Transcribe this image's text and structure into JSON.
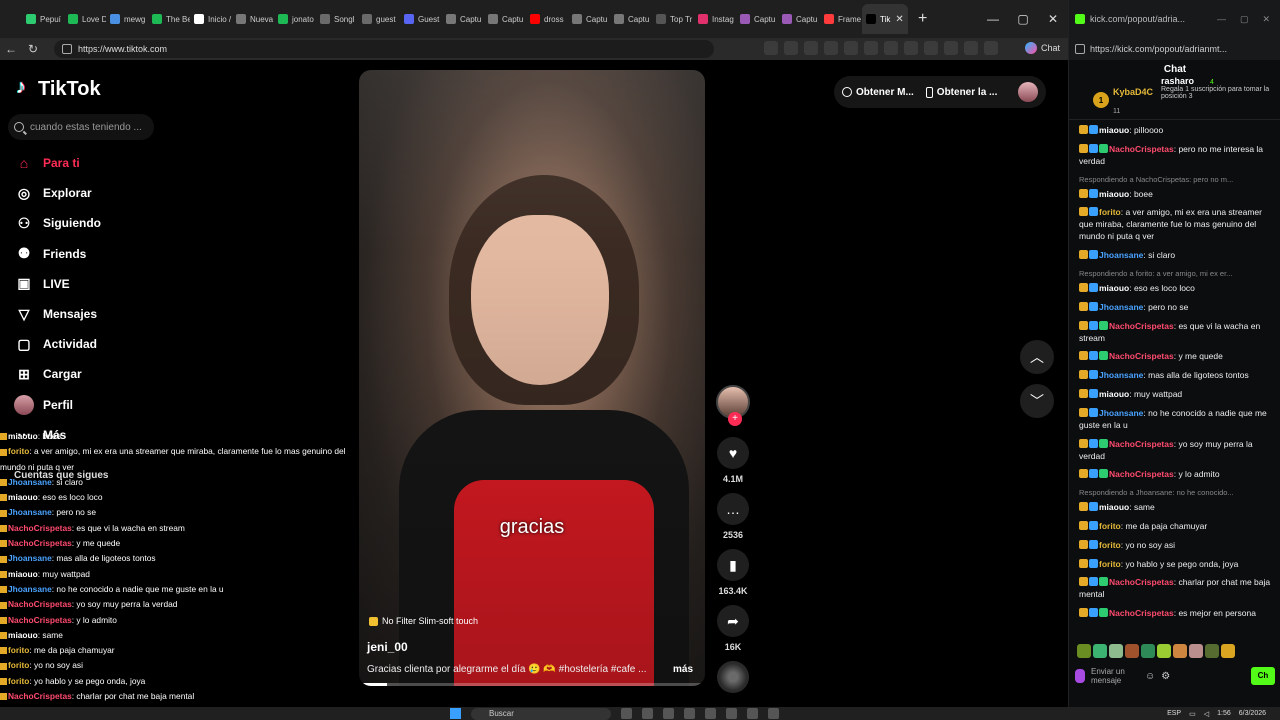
{
  "browser": {
    "tabs": [
      {
        "label": "Pepuí",
        "color": "#2ecc71"
      },
      {
        "label": "Love D",
        "color": "#1db954"
      },
      {
        "label": "mewg",
        "color": "#4a90e2"
      },
      {
        "label": "The Be",
        "color": "#1db954"
      },
      {
        "label": "Inicio /",
        "color": "#ffffff"
      },
      {
        "label": "Nueva",
        "color": "#777777"
      },
      {
        "label": "jonato",
        "color": "#1db954"
      },
      {
        "label": "Songl",
        "color": "#6a6a6a"
      },
      {
        "label": "guest",
        "color": "#6a6a6a"
      },
      {
        "label": "Guest",
        "color": "#5865f2"
      },
      {
        "label": "Captu",
        "color": "#777777"
      },
      {
        "label": "Captu",
        "color": "#777777"
      },
      {
        "label": "dross",
        "color": "#ff0000"
      },
      {
        "label": "Captu",
        "color": "#777777"
      },
      {
        "label": "Captu",
        "color": "#777777"
      },
      {
        "label": "Top Tr",
        "color": "#555555"
      },
      {
        "label": "Instag",
        "color": "#e1306c"
      },
      {
        "label": "Captu",
        "color": "#9b59b6"
      },
      {
        "label": "Captu",
        "color": "#9b59b6"
      },
      {
        "label": "Frame",
        "color": "#ff3b3b"
      },
      {
        "label": "Tik",
        "color": "#000000",
        "active": true
      }
    ],
    "url": "https://www.tiktok.com",
    "copilot_label": "Chat"
  },
  "tiktok": {
    "brand": "TikTok",
    "search_placeholder": "cuando estas teniendo ...",
    "nav": [
      {
        "label": "Para ti",
        "icon": "home-icon",
        "glyph": "⌂",
        "active": true
      },
      {
        "label": "Explorar",
        "icon": "compass-icon",
        "glyph": "◎"
      },
      {
        "label": "Siguiendo",
        "icon": "following-icon",
        "glyph": "⚇"
      },
      {
        "label": "Friends",
        "icon": "friends-icon",
        "glyph": "⚉"
      },
      {
        "label": "LIVE",
        "icon": "live-icon",
        "glyph": "▣"
      },
      {
        "label": "Mensajes",
        "icon": "messages-icon",
        "glyph": "▽"
      },
      {
        "label": "Actividad",
        "icon": "activity-icon",
        "glyph": "▢"
      },
      {
        "label": "Cargar",
        "icon": "upload-icon",
        "glyph": "⊞"
      },
      {
        "label": "Perfil",
        "icon": "profile-avatar",
        "glyph": ""
      },
      {
        "label": "Más",
        "icon": "more-icon",
        "glyph": "⋯"
      }
    ],
    "following_title": "Cuentas que sigues",
    "top_actions": {
      "coins": "Obtener M...",
      "app": "Obtener la ..."
    },
    "video": {
      "caption": "gracias",
      "effect": "No Filter Slim-soft touch",
      "username": "jeni_00",
      "description": "Gracias clienta por alegrarme el día 🥲 🫶 #hostelería #cafe ...",
      "more": "más",
      "progress": 0.08
    },
    "stats": {
      "likes": "4.1M",
      "comments": "2536",
      "saves": "163.4K",
      "shares": "16K"
    }
  },
  "overlay_chat": [
    {
      "user": "miaouo",
      "text": ": boee",
      "color": "#ffffff"
    },
    {
      "user": "forito",
      "text": ": a ver amigo, mi ex era una streamer que miraba, claramente fue lo mas genuino del mundo ni puta q ver",
      "color": "#e5b93a"
    },
    {
      "user": "Jhoansane",
      "text": ": si claro",
      "color": "#4aa3ff"
    },
    {
      "user": "miaouo",
      "text": ": eso es loco loco",
      "color": "#ffffff"
    },
    {
      "user": "Jhoansane",
      "text": ": pero no se",
      "color": "#4aa3ff"
    },
    {
      "user": "NachoCrispetas",
      "text": ": es que vi la wacha en stream",
      "color": "#ff4b6e"
    },
    {
      "user": "NachoCrispetas",
      "text": ": y me quede",
      "color": "#ff4b6e"
    },
    {
      "user": "Jhoansane",
      "text": ": mas alla de ligoteos tontos",
      "color": "#4aa3ff"
    },
    {
      "user": "miaouo",
      "text": ": muy wattpad",
      "color": "#ffffff"
    },
    {
      "user": "Jhoansane",
      "text": ": no he conocido a nadie que me guste en la u",
      "color": "#4aa3ff"
    },
    {
      "user": "NachoCrispetas",
      "text": ": yo soy muy perra la verdad",
      "color": "#ff4b6e"
    },
    {
      "user": "NachoCrispetas",
      "text": ": y lo admito",
      "color": "#ff4b6e"
    },
    {
      "user": "miaouo",
      "text": ": same",
      "color": "#ffffff"
    },
    {
      "user": "forito",
      "text": ": me da paja chamuyar",
      "color": "#e5b93a"
    },
    {
      "user": "forito",
      "text": ": yo no soy asi",
      "color": "#e5b93a"
    },
    {
      "user": "forito",
      "text": ": yo hablo y se pego onda, joya",
      "color": "#e5b93a"
    },
    {
      "user": "NachoCrispetas",
      "text": ": charlar por chat me baja mental",
      "color": "#ff4b6e"
    },
    {
      "user": "NachoCrispetas",
      "text": ": es mejor en persona",
      "color": "#ff4b6e"
    }
  ],
  "kick": {
    "window_title": "kick.com/popout/adria...",
    "url": "https://kick.com/popout/adrianmt...",
    "chat_label": "Chat",
    "pinned_top": {
      "rank": "1",
      "user": "KybaD4C",
      "sub": "11"
    },
    "pinned_gift": {
      "user": "rasharo",
      "count": "4",
      "text": "Regala 1 suscripción para tomar la posición 3"
    },
    "messages": [
      {
        "user": "miaouo",
        "text": ": pilloooo",
        "color": "#ffffff"
      },
      {
        "user": "NachoCrispetas",
        "text": ": pero no me interesa la verdad",
        "color": "#ff4b6e"
      },
      {
        "reply": "Respondiendo a NachoCrispetas: pero no m..."
      },
      {
        "user": "miaouo",
        "text": ": boee",
        "color": "#ffffff"
      },
      {
        "user": "forito",
        "text": ": a ver amigo, mi ex era una streamer que miraba, claramente fue lo mas genuino del mundo ni puta q ver",
        "color": "#e5b93a"
      },
      {
        "user": "Jhoansane",
        "text": ": si claro",
        "color": "#4aa3ff"
      },
      {
        "reply": "Respondiendo a forito: a ver amigo, mi ex er..."
      },
      {
        "user": "miaouo",
        "text": ": eso es loco loco",
        "color": "#ffffff"
      },
      {
        "user": "Jhoansane",
        "text": ": pero no se",
        "color": "#4aa3ff"
      },
      {
        "user": "NachoCrispetas",
        "text": ": es que vi la wacha en stream",
        "color": "#ff4b6e"
      },
      {
        "user": "NachoCrispetas",
        "text": ": y me quede",
        "color": "#ff4b6e"
      },
      {
        "user": "Jhoansane",
        "text": ": mas alla de ligoteos tontos",
        "color": "#4aa3ff"
      },
      {
        "user": "miaouo",
        "text": ": muy wattpad",
        "color": "#ffffff"
      },
      {
        "user": "Jhoansane",
        "text": ": no he conocido a nadie que me guste en la u",
        "color": "#4aa3ff"
      },
      {
        "user": "NachoCrispetas",
        "text": ": yo soy muy perra la verdad",
        "color": "#ff4b6e"
      },
      {
        "user": "NachoCrispetas",
        "text": ": y lo admito",
        "color": "#ff4b6e"
      },
      {
        "reply": "Respondiendo a Jhoansane: no he conocido..."
      },
      {
        "user": "miaouo",
        "text": ": same",
        "color": "#ffffff"
      },
      {
        "user": "forito",
        "text": ": me da paja chamuyar",
        "color": "#e5b93a"
      },
      {
        "user": "forito",
        "text": ": yo no soy asi",
        "color": "#e5b93a"
      },
      {
        "user": "forito",
        "text": ": yo hablo y se pego onda, joya",
        "color": "#e5b93a"
      },
      {
        "user": "NachoCrispetas",
        "text": ": charlar por chat me baja mental",
        "color": "#ff4b6e"
      },
      {
        "user": "NachoCrispetas",
        "text": ": es mejor en persona",
        "color": "#ff4b6e"
      }
    ],
    "input_placeholder": "Enviar un mensaje",
    "send_label": "Ch"
  },
  "taskbar": {
    "search": "Buscar",
    "lang": "ESP",
    "time": "1:56",
    "date": "6/3/2026"
  }
}
